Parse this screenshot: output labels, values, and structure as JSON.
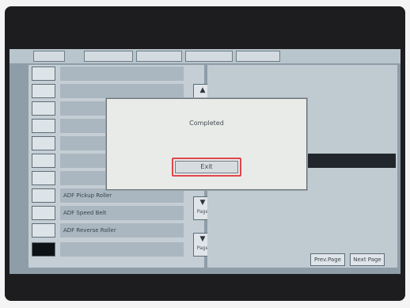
{
  "dialog": {
    "message": "Completed",
    "exit_label": "Exit"
  },
  "menu": {
    "items": [
      {
        "label": ""
      },
      {
        "label": ""
      },
      {
        "label": ""
      },
      {
        "label": ""
      },
      {
        "label": ""
      },
      {
        "label": ""
      },
      {
        "label": ""
      },
      {
        "label": "ADF Pickup Roller"
      },
      {
        "label": "ADF Speed Belt"
      },
      {
        "label": "ADF Reverse Roller"
      },
      {
        "label": ""
      }
    ],
    "scroll_up_label": "",
    "scroll_down_label": "Page",
    "scroll_down2_label": "Page"
  },
  "nav": {
    "prev_label": "Prev.Page",
    "next_label": "Next Page"
  },
  "status": {
    "left_line1": "",
    "left_line2": "",
    "right_line1": "",
    "right_line2": ""
  },
  "colors": {
    "highlight": "#e0454c"
  }
}
